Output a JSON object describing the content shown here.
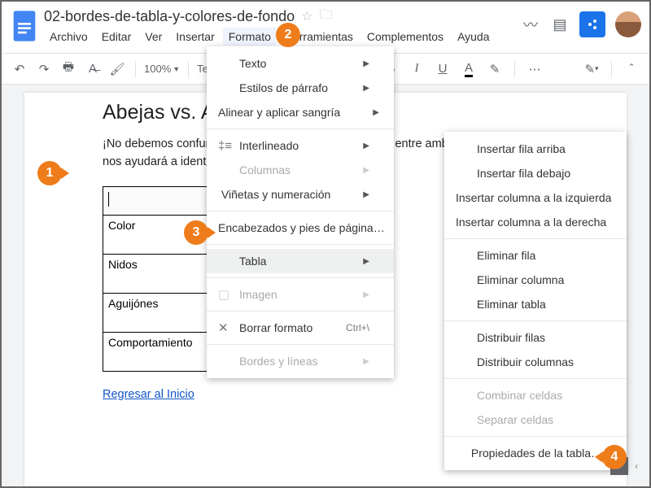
{
  "header": {
    "doc_title": "02-bordes-de-tabla-y-colores-de-fondo",
    "menus": [
      "Archivo",
      "Editar",
      "Ver",
      "Insertar",
      "Formato",
      "Herramientas",
      "Complementos",
      "Ayuda"
    ],
    "active_menu_index": 4
  },
  "toolbar": {
    "zoom": "100%",
    "field_left": "Tex"
  },
  "document": {
    "heading": "Abejas vs. Avispas",
    "paragraph": "¡No debemos confundirlas! Existen grandes diferencias entre ambas. La tabla debajo nos ayudará a identificarlas.",
    "table_rows": [
      "",
      "Color",
      "Nidos",
      "Aguijónes",
      "Comportamiento"
    ],
    "link_text": "Regresar al Inicio"
  },
  "format_menu": [
    {
      "label": "Texto",
      "arrow": true
    },
    {
      "label": "Estilos de párrafo",
      "arrow": true
    },
    {
      "label": "Alinear y aplicar sangría",
      "arrow": true
    },
    {
      "sep": true
    },
    {
      "label": "Interlineado",
      "icon": "‡≡",
      "arrow": true
    },
    {
      "label": "Columnas",
      "arrow": true,
      "disabled": true
    },
    {
      "label": "Viñetas y numeración",
      "arrow": true
    },
    {
      "sep": true
    },
    {
      "label": "Encabezados y pies de página…"
    },
    {
      "sep": true
    },
    {
      "label": "Tabla",
      "arrow": true,
      "highlight": true
    },
    {
      "sep": true
    },
    {
      "label": "Imagen",
      "icon": "▢",
      "arrow": true,
      "disabled": true
    },
    {
      "sep": true
    },
    {
      "label": "Borrar formato",
      "icon": "✕",
      "shortcut": "Ctrl+\\"
    },
    {
      "sep": true
    },
    {
      "label": "Bordes y líneas",
      "arrow": true,
      "disabled": true
    }
  ],
  "table_menu": [
    {
      "label": "Insertar fila arriba"
    },
    {
      "label": "Insertar fila debajo"
    },
    {
      "label": "Insertar columna a la izquierda"
    },
    {
      "label": "Insertar columna a la derecha"
    },
    {
      "sep": true
    },
    {
      "label": "Eliminar fila"
    },
    {
      "label": "Eliminar columna"
    },
    {
      "label": "Eliminar tabla"
    },
    {
      "sep": true
    },
    {
      "label": "Distribuir filas"
    },
    {
      "label": "Distribuir columnas"
    },
    {
      "sep": true
    },
    {
      "label": "Combinar celdas",
      "disabled": true
    },
    {
      "label": "Separar celdas",
      "disabled": true
    },
    {
      "sep": true
    },
    {
      "label": "Propiedades de la tabla…"
    }
  ],
  "callouts": {
    "1": "1",
    "2": "2",
    "3": "3",
    "4": "4"
  }
}
